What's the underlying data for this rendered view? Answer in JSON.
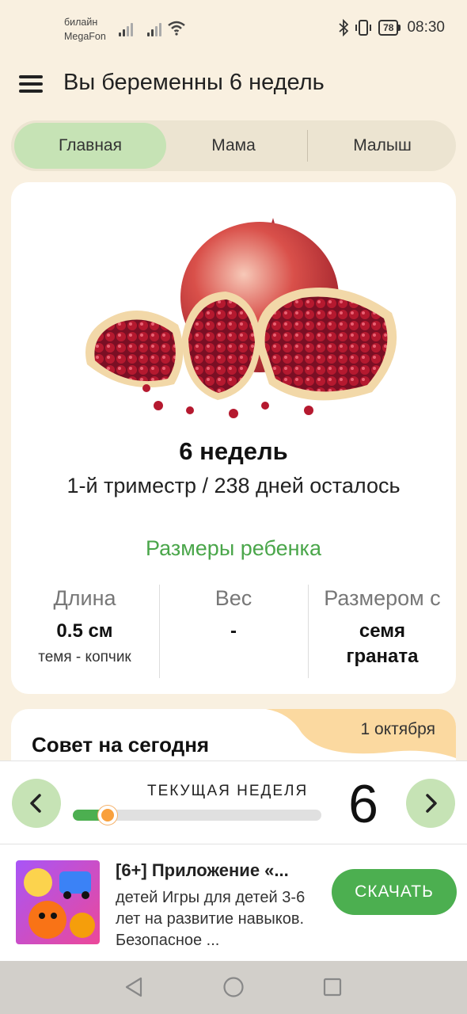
{
  "status_bar": {
    "carrier_1": "билайн",
    "carrier_2": "MegaFon",
    "battery": "78",
    "time": "08:30"
  },
  "header": {
    "title": "Вы беременны 6 недель"
  },
  "tabs": [
    {
      "label": "Главная",
      "active": true
    },
    {
      "label": "Мама",
      "active": false
    },
    {
      "label": "Малыш",
      "active": false
    }
  ],
  "week_card": {
    "week_heading": "6 недель",
    "trimester_info": "1-й триместр / 238 дней осталось",
    "sizes_title": "Размеры ребенка",
    "length": {
      "label": "Длина",
      "value": "0.5 см",
      "note": "темя - копчик"
    },
    "weight": {
      "label": "Вес",
      "value": "-"
    },
    "size_as": {
      "label": "Размером с",
      "value": "семя граната"
    }
  },
  "advice": {
    "date": "1 октября",
    "title": "Совет на сегодня"
  },
  "week_nav": {
    "label": "ТЕКУЩАЯ НЕДЕЛЯ",
    "week_number": "6",
    "progress_fraction": 0.14
  },
  "ad": {
    "title": "[6+] Приложение «...",
    "text": "детей Игры для детей 3-6 лет на развитие навыков. Безопасное ...",
    "button": "СКАЧАТЬ"
  },
  "colors": {
    "background": "#f9f0e0",
    "accent_green": "#4caf50",
    "tab_active": "#c6e3b5",
    "sizes_title": "#4aa64a",
    "progress_knob": "#f9a03c"
  }
}
